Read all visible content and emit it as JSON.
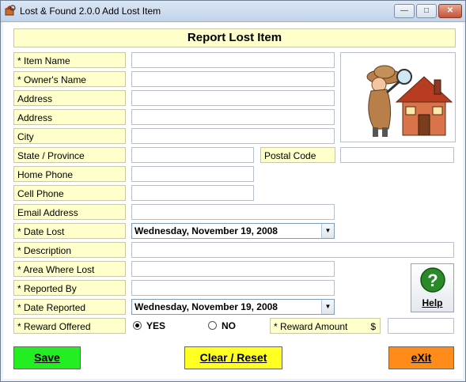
{
  "window": {
    "title": "Lost & Found  2.0.0  Add Lost Item",
    "minimize_glyph": "—",
    "maximize_glyph": "□",
    "close_glyph": "✕"
  },
  "form": {
    "header": "Report  Lost  Item",
    "labels": {
      "item_name": "* Item Name",
      "owner_name": "* Owner's Name",
      "address1": "Address",
      "address2": "Address",
      "city": "City",
      "state": "State / Province",
      "postal_code": "Postal Code",
      "home_phone": "Home Phone",
      "cell_phone": "Cell Phone",
      "email": "Email Address",
      "date_lost": "* Date Lost",
      "description": "* Description",
      "area_lost": "* Area Where Lost",
      "reported_by": "* Reported By",
      "date_reported": "* Date Reported",
      "reward_offered": "* Reward Offered",
      "reward_amount": "* Reward Amount",
      "currency": "$"
    },
    "values": {
      "date_lost": "Wednesday,  November  19, 2008",
      "date_reported": "Wednesday,  November  19, 2008",
      "reward_yes": "YES",
      "reward_no": "NO",
      "reward_selected": "YES"
    }
  },
  "buttons": {
    "help": "Help",
    "save": "Save",
    "clear": "Clear / Reset",
    "exit": "eXit"
  },
  "colors": {
    "label_bg": "#ffffcc",
    "save": "#22ee22",
    "clear": "#ffff22",
    "exit": "#ff8c1a",
    "help_icon": "#2a8a2a"
  }
}
